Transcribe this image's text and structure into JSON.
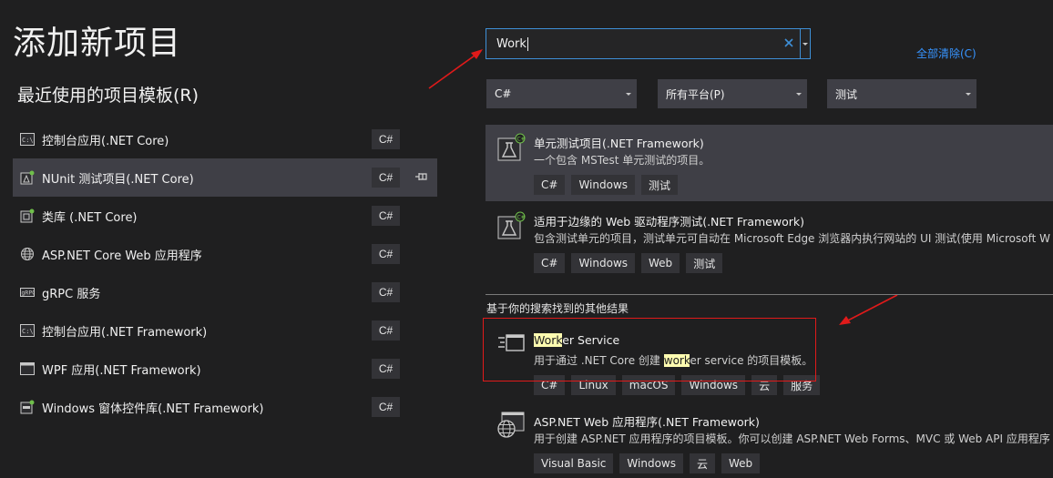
{
  "dialog": {
    "title": "添加新项目",
    "recent_title": "最近使用的项目模板(R)"
  },
  "recent_templates": [
    {
      "label": "控制台应用(.NET Core)",
      "lang": "C#"
    },
    {
      "label": "NUnit 测试项目(.NET Core)",
      "lang": "C#"
    },
    {
      "label": "类库 (.NET Core)",
      "lang": "C#"
    },
    {
      "label": "ASP.NET Core Web 应用程序",
      "lang": "C#"
    },
    {
      "label": "gRPC 服务",
      "lang": "C#"
    },
    {
      "label": "控制台应用(.NET Framework)",
      "lang": "C#"
    },
    {
      "label": "WPF 应用(.NET Framework)",
      "lang": "C#"
    },
    {
      "label": "Windows 窗体控件库(.NET Framework)",
      "lang": "C#"
    }
  ],
  "search": {
    "value": "Work",
    "clear_all": "全部清除(C)"
  },
  "filters": {
    "language": "C#",
    "platform": "所有平台(P)",
    "project_type": "测试"
  },
  "results": [
    {
      "title": "单元测试项目(.NET Framework)",
      "desc": "一个包含 MSTest 单元测试的项目。",
      "tags": [
        "C#",
        "Windows",
        "测试"
      ]
    },
    {
      "title": "适用于边缘的 Web 驱动程序测试(.NET Framework)",
      "desc": "包含测试单元的项目，测试单元可自动在 Microsoft Edge 浏览器内执行网站的 UI 测试(使用 Microsoft W",
      "tags": [
        "C#",
        "Windows",
        "Web",
        "测试"
      ]
    }
  ],
  "other_results_label": "基于你的搜索找到的其他结果",
  "other_results": [
    {
      "title_highlight": "Work",
      "title_rest": "er Service",
      "desc_pre": "用于通过 .NET Core 创建 ",
      "desc_highlight": "work",
      "desc_post": "er service 的项目模板。",
      "tags": [
        "C#",
        "Linux",
        "macOS",
        "Windows",
        "云",
        "服务"
      ]
    },
    {
      "title": "ASP.NET Web 应用程序(.NET Framework)",
      "desc": "用于创建 ASP.NET 应用程序的项目模板。你可以创建 ASP.NET Web Forms、MVC 或 Web API 应用程序",
      "tags": [
        "Visual Basic",
        "Windows",
        "云",
        "Web"
      ]
    }
  ]
}
